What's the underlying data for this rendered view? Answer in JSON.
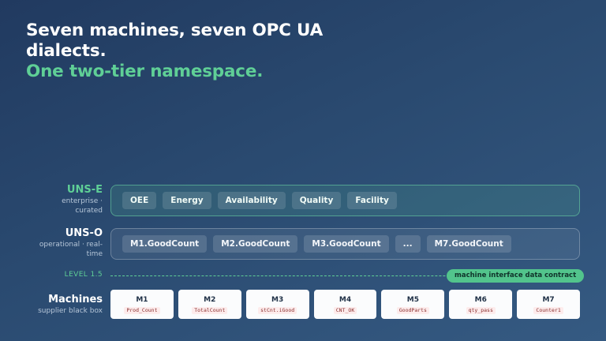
{
  "title": {
    "line1": "Seven machines, seven OPC UA",
    "line2": "dialects.",
    "accent": "One two-tier namespace."
  },
  "uns_e": {
    "name": "UNS-E",
    "sub_line1": "enterprise ·",
    "sub_line2": "curated",
    "chips": [
      "OEE",
      "Energy",
      "Availability",
      "Quality",
      "Facility"
    ]
  },
  "uns_o": {
    "name": "UNS-O",
    "sub_line1": "operational · real-",
    "sub_line2": "time",
    "chips": [
      "M1.GoodCount",
      "M2.GoodCount",
      "M3.GoodCount",
      "...",
      "M7.GoodCount"
    ]
  },
  "level": {
    "label": "LEVEL 1.5",
    "contract": "machine interface data contract"
  },
  "machines_row": {
    "name": "Machines",
    "sub": "supplier black box",
    "items": [
      {
        "name": "M1",
        "tag": "Prod_Count"
      },
      {
        "name": "M2",
        "tag": "TotalCount"
      },
      {
        "name": "M3",
        "tag": "stCnt.iGood"
      },
      {
        "name": "M4",
        "tag": "CNT_OK"
      },
      {
        "name": "M5",
        "tag": "GoodParts"
      },
      {
        "name": "M6",
        "tag": "qty_pass"
      },
      {
        "name": "M7",
        "tag": "Counter1"
      }
    ]
  },
  "colors": {
    "accent_green": "#5fcf96",
    "background": "#2a4a70",
    "tag_text": "#8a2e2e"
  }
}
